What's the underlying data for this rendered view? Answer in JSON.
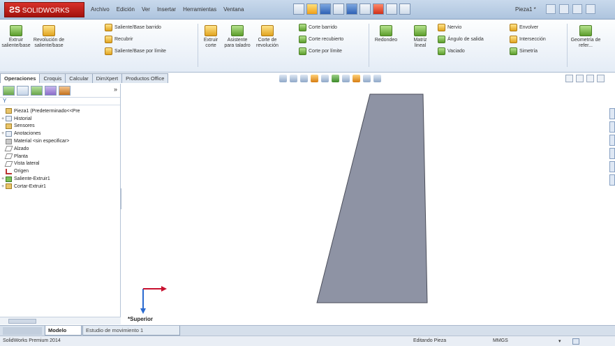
{
  "app": {
    "logo_mark": "ƧS",
    "logo_text": "SOLIDWORKS",
    "document": "Pieza1 *"
  },
  "menu": [
    "Archivo",
    "Edición",
    "Ver",
    "Insertar",
    "Herramientas",
    "Ventana"
  ],
  "ribbon": {
    "extrude_boss": "Extruir saliente/base",
    "revolve_boss": "Revolución de saliente/base",
    "swept_boss": "Saliente/Base barrido",
    "loft_boss": "Recubrir",
    "boundary_boss": "Saliente/Base por límite",
    "extrude_cut": "Extruir corte",
    "hole_wizard": "Asistente para taladro",
    "revolve_cut": "Corte de revolución",
    "swept_cut": "Corte barrido",
    "lofted_cut": "Corte recubierto",
    "boundary_cut": "Corte por límite",
    "fillet": "Redondeo",
    "linear_pattern": "Matriz lineal",
    "rib": "Nervio",
    "draft": "Ángulo de salida",
    "shell": "Vaciado",
    "wrap": "Envolver",
    "intersect": "Intersección",
    "mirror": "Simetría",
    "reference_geometry": "Geometría de refer..."
  },
  "tabs": [
    "Operaciones",
    "Croquis",
    "Calcular",
    "DimXpert",
    "Productos Office"
  ],
  "tree": {
    "filter_symbol": "Y",
    "part": "Pieza1 (Predeterminado<<Pre",
    "items": [
      "Historial",
      "Sensores",
      "Anotaciones",
      "Material <sin especificar>",
      "Alzado",
      "Planta",
      "Vista lateral",
      "Origen",
      "Saliente-Extruir1",
      "Cortar-Extruir1"
    ]
  },
  "panel_more": "»",
  "view": {
    "orientation": "*Superior"
  },
  "bottom_tabs": {
    "model": "Modelo",
    "motion": "Estudio de movimiento 1"
  },
  "status": {
    "app": "SolidWorks Premium 2014",
    "mode": "Editando Pieza",
    "units": "MMGS",
    "units_arrow": "▾"
  },
  "colors": {
    "part_fill": "#8e93a4",
    "part_stroke": "#4b4e5a",
    "accent": "#c8102e"
  }
}
